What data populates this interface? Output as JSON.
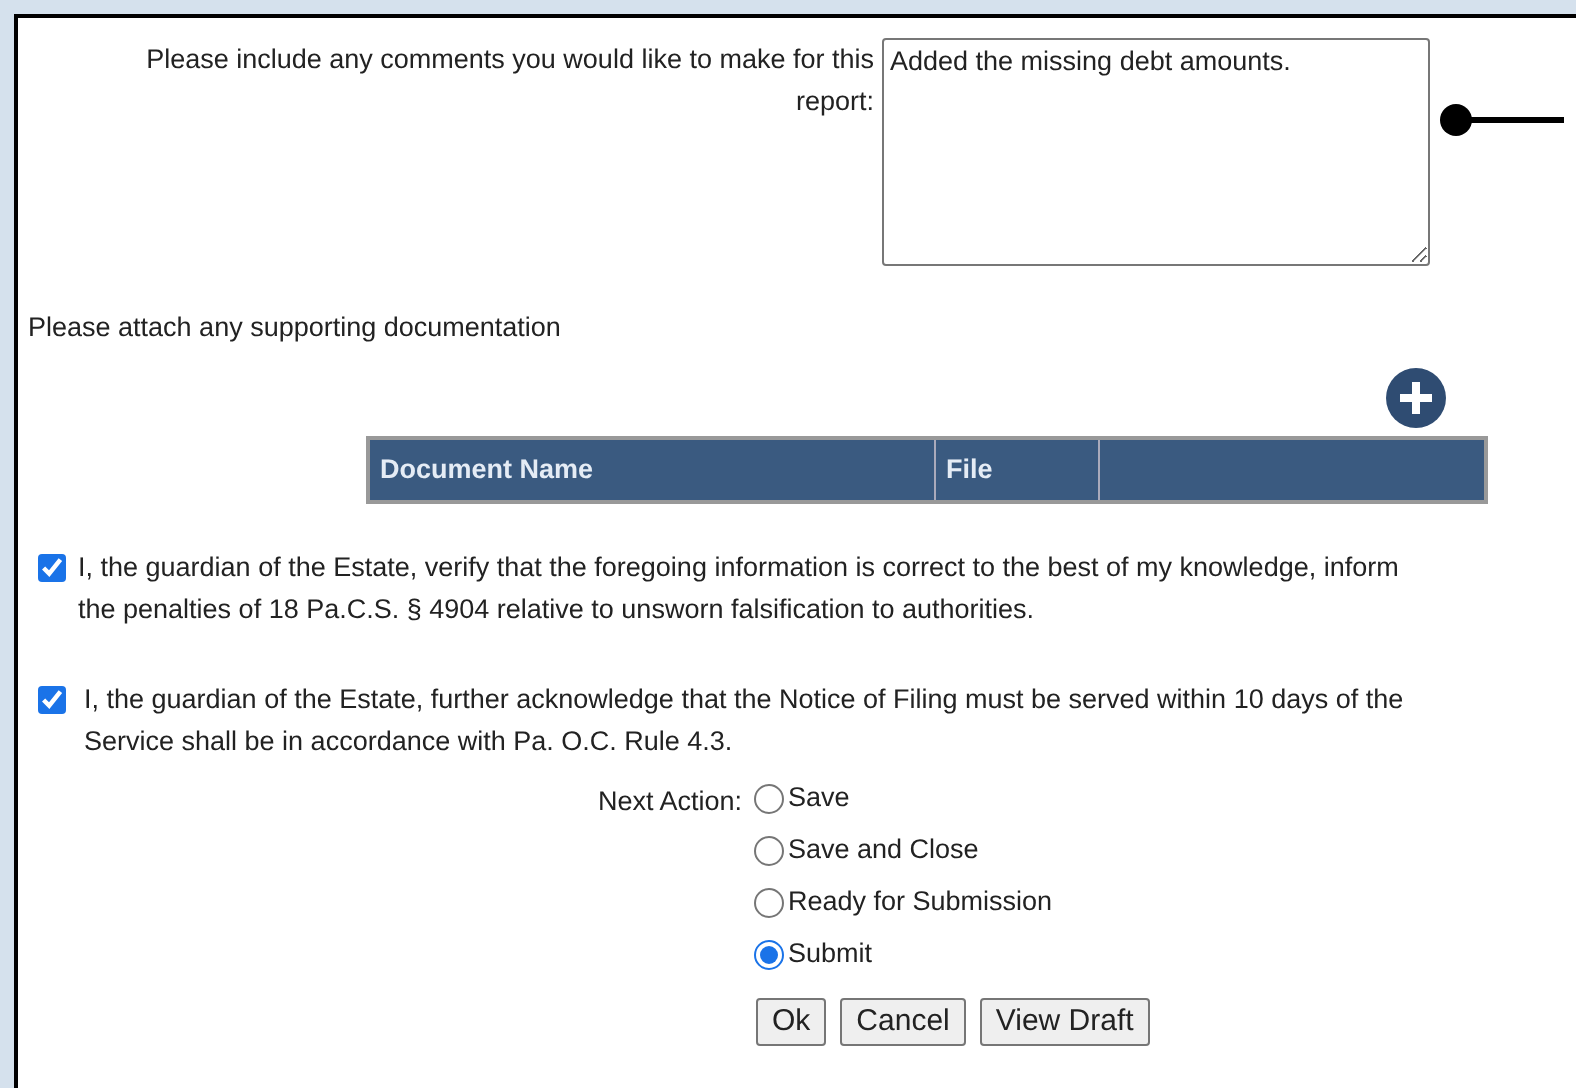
{
  "comments": {
    "label": "Please include any comments you would like to make for this report:",
    "value": "Added the missing debt amounts."
  },
  "attachments": {
    "label": "Please attach any supporting documentation",
    "columns": [
      "Document Name",
      "File"
    ]
  },
  "acknowledgements": [
    {
      "lines": [
        "I, the guardian of the Estate, verify that the foregoing information is correct to the best of my knowledge, inform",
        "the penalties of 18 Pa.C.S. § 4904 relative to unsworn falsification to authorities."
      ],
      "checked": true
    },
    {
      "lines": [
        "I, the guardian of the Estate, further acknowledge that the Notice of Filing must be served within 10 days of the",
        "Service shall be in accordance with Pa. O.C. Rule 4.3."
      ],
      "checked": true
    }
  ],
  "next_action": {
    "label": "Next Action:",
    "options": [
      {
        "label": "Save",
        "selected": false
      },
      {
        "label": "Save and Close",
        "selected": false
      },
      {
        "label": "Ready for Submission",
        "selected": false
      },
      {
        "label": "Submit",
        "selected": true
      }
    ]
  },
  "buttons": [
    "Ok",
    "Cancel",
    "View Draft"
  ]
}
